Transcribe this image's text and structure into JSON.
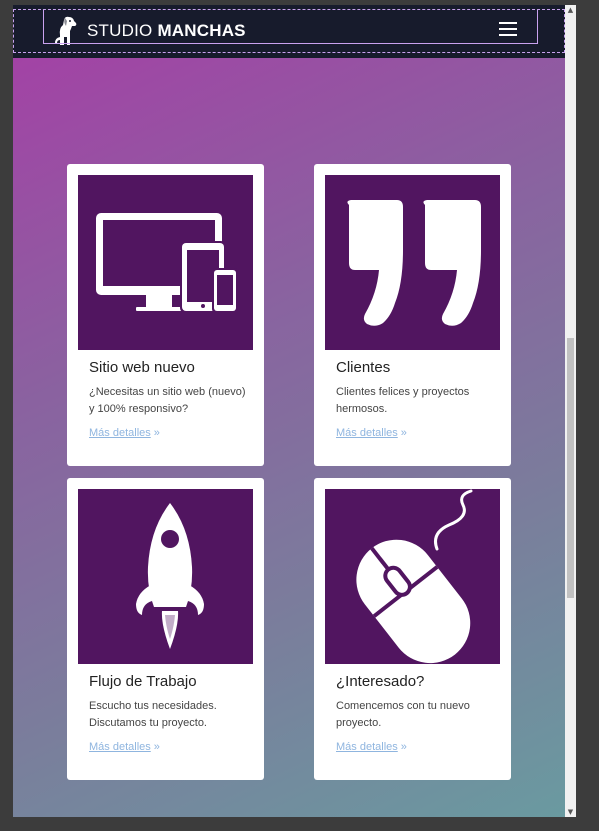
{
  "navbar": {
    "brand_light": "STUDIO",
    "brand_bold": "MANCHAS",
    "menu_icon": "hamburger-icon",
    "logo_icon": "dog-logo-icon"
  },
  "colors": {
    "navbar_bg": "#171b2c",
    "card_image_bg": "#511560",
    "link": "#8fb5df",
    "gradient_start": "#a63ea6",
    "gradient_end": "#6a9aa0"
  },
  "cards": [
    {
      "icon": "devices-icon",
      "title": "Sitio web nuevo",
      "text": "¿Necesitas un sitio web (nuevo) y 100% responsivo?",
      "link": "Más detalles"
    },
    {
      "icon": "quote-icon",
      "title": "Clientes",
      "text": "Clientes felices y proyectos hermosos.",
      "link": "Más detalles"
    },
    {
      "icon": "rocket-icon",
      "title": "Flujo de Trabajo",
      "text": "Escucho tus necesidades. Discutamos tu proyecto.",
      "link": "Más detalles"
    },
    {
      "icon": "mouse-icon",
      "title": "¿Interesado?",
      "text": "Comencemos con tu nuevo proyecto.",
      "link": "Más detalles"
    }
  ]
}
